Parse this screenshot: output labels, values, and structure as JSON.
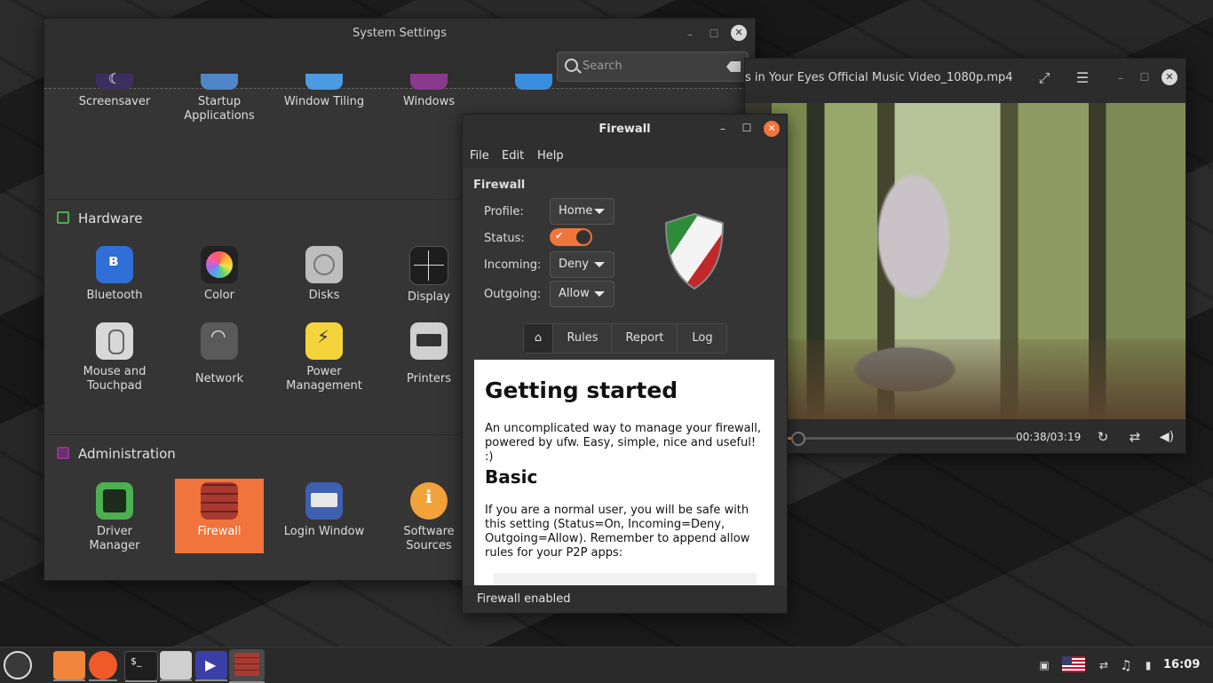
{
  "settings": {
    "title": "System Settings",
    "search_placeholder": "Search",
    "top_items": [
      "Screensaver",
      "Startup Applications",
      "Window Tiling",
      "Windows"
    ],
    "hardware_header": "Hardware",
    "hardware_items": [
      "Bluetooth",
      "Color",
      "Disks",
      "Display",
      "Mouse and Touchpad",
      "Network",
      "Power Management",
      "Printers"
    ],
    "admin_header": "Administration",
    "admin_items": [
      "Driver Manager",
      "Firewall",
      "Login Window",
      "Software Sources"
    ],
    "selected_item": "Firewall"
  },
  "player": {
    "title": "s in Your Eyes Official Music Video_1080p.mp4",
    "time": "00:38/03:19",
    "progress_fraction": 0.19
  },
  "firewall": {
    "title": "Firewall",
    "menu": [
      "File",
      "Edit",
      "Help"
    ],
    "section": "Firewall",
    "profile_label": "Profile:",
    "profile_value": "Home",
    "status_label": "Status:",
    "status_on": true,
    "incoming_label": "Incoming:",
    "incoming_value": "Deny",
    "outgoing_label": "Outgoing:",
    "outgoing_value": "Allow",
    "tabs": [
      "Rules",
      "Report",
      "Log"
    ],
    "content": {
      "heading": "Getting started",
      "intro": "An uncomplicated way to manage your firewall, powered by ufw. Easy, simple, nice and useful! :)",
      "subheading": "Basic",
      "basic_text": "If you are a normal user, you will be safe with this setting (Status=On, Incoming=Deny, Outgoing=Allow). Remember to append allow rules for your P2P apps:"
    },
    "statusbar": "Firewall enabled"
  },
  "taskbar": {
    "apps": [
      "menu-icon",
      "files-icon",
      "firefox-icon",
      "terminal-icon",
      "settings-icon",
      "video-icon",
      "firewall-icon"
    ],
    "clock": "16:09"
  },
  "colors": {
    "accent": "#f0743b",
    "window_bg": "#353535",
    "titlebar_bg": "#2e2e2e"
  }
}
